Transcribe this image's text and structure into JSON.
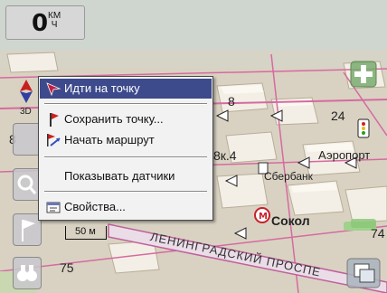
{
  "speedometer": {
    "value": "0",
    "unit_top": "КМ",
    "unit_bottom": "Ч"
  },
  "context_menu": {
    "items": [
      {
        "label": "Идти на точку",
        "selected": true
      },
      {
        "label": "Сохранить точку..."
      },
      {
        "label": "Начать маршрут"
      },
      {
        "label": "Показывать датчики"
      },
      {
        "label": "Свойства..."
      }
    ]
  },
  "map": {
    "scale": "50 м",
    "labels": {
      "building_8": "8",
      "number_24": "24",
      "building_8k4": "8к.4",
      "airport": "Аэропорт",
      "sberbank": "Сбербанк",
      "sokol": "Сокол",
      "street": "ЛЕНИНГРАДСКИЙ ПРОСПЕ",
      "number_74": "74",
      "number_75": "75",
      "partial_8": "8",
      "partial_3d": "3D"
    }
  },
  "colors": {
    "menu_highlight": "#3d4a8c",
    "road_pink": "#d66aa0",
    "building": "#f3efe6"
  }
}
